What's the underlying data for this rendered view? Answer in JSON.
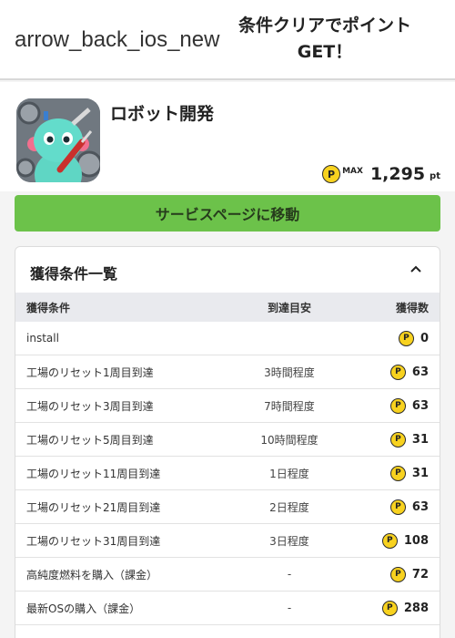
{
  "header": {
    "back_label": "arrow_back_ios_new",
    "title_line1": "条件クリアでポイント",
    "title_line2": "GET！"
  },
  "app": {
    "name": "ロボット開発",
    "max_label": "MAX",
    "points": "1,295",
    "points_unit": "pt",
    "coin_letter": "P"
  },
  "service_button": "サービスページに移動",
  "conditions": {
    "title": "獲得条件一覧",
    "columns": [
      "獲得条件",
      "到達目安",
      "獲得数"
    ],
    "rows": [
      {
        "condition": "install",
        "estimate": "",
        "points": "0"
      },
      {
        "condition": "工場のリセット1周目到達",
        "estimate": "3時間程度",
        "points": "63"
      },
      {
        "condition": "工場のリセット3周目到達",
        "estimate": "7時間程度",
        "points": "63"
      },
      {
        "condition": "工場のリセット5周目到達",
        "estimate": "10時間程度",
        "points": "31"
      },
      {
        "condition": "工場のリセット11周目到達",
        "estimate": "1日程度",
        "points": "31"
      },
      {
        "condition": "工場のリセット21周目到達",
        "estimate": "2日程度",
        "points": "63"
      },
      {
        "condition": "工場のリセット31周目到達",
        "estimate": "3日程度",
        "points": "108"
      },
      {
        "condition": "高純度燃料を購入（課金）",
        "estimate": "-",
        "points": "72"
      },
      {
        "condition": "最新OSの購入（課金）",
        "estimate": "-",
        "points": "288"
      }
    ]
  }
}
